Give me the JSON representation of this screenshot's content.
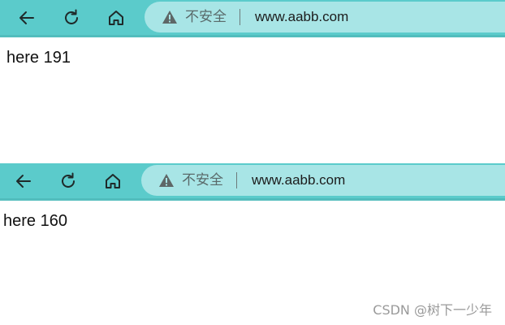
{
  "windows": [
    {
      "security_label": "不安全",
      "url": "www.aabb.com",
      "content_text": "here 191"
    },
    {
      "security_label": "不安全",
      "url": "www.aabb.com",
      "content_text": "here 160"
    }
  ],
  "icons": {
    "back": "arrow-left-icon",
    "refresh": "refresh-icon",
    "home": "home-icon",
    "warning": "warning-triangle-icon"
  },
  "colors": {
    "toolbar": "#5bcbcb",
    "address_bar": "#a8e5e6"
  },
  "watermark": "CSDN @树下一少年"
}
